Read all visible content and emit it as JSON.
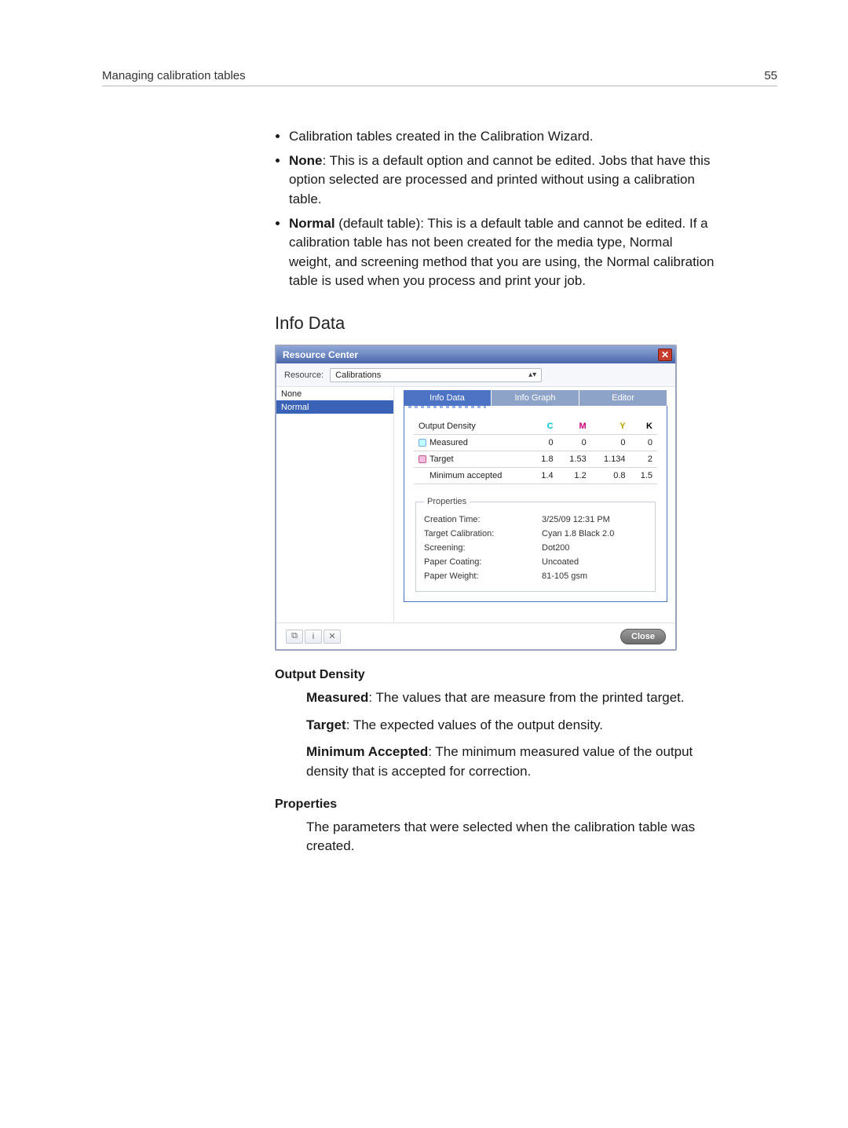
{
  "page": {
    "running_head": "Managing calibration tables",
    "page_number": "55"
  },
  "bullets": {
    "b1": "Calibration tables created in the Calibration Wizard.",
    "b2_label": "None",
    "b2_rest": ": This is a default option and cannot be edited. Jobs that have this option selected are processed and printed without using a calibration table.",
    "b3_label": "Normal",
    "b3_paren": " (default table): This is a default table and cannot be edited. If a calibration table has not been created for the media type, Normal weight, and screening method that you are using, the Normal calibration table is used when you process and print your job."
  },
  "heading": "Info Data",
  "window": {
    "title": "Resource Center",
    "resource_label": "Resource:",
    "resource_value": "Calibrations",
    "list": {
      "item0": "None",
      "item1": "Normal"
    },
    "tabs": {
      "info_data": "Info Data",
      "info_graph": "Info Graph",
      "editor": "Editor"
    },
    "table": {
      "h_output": "Output Density",
      "h_c": "C",
      "h_m": "M",
      "h_y": "Y",
      "h_k": "K",
      "r_measured": "Measured",
      "m_c": "0",
      "m_m": "0",
      "m_y": "0",
      "m_k": "0",
      "r_target": "Target",
      "t_c": "1.8",
      "t_m": "1.53",
      "t_y": "1.134",
      "t_k": "2",
      "r_min": "Minimum accepted",
      "x_c": "1.4",
      "x_m": "1.2",
      "x_y": "0.8",
      "x_k": "1.5"
    },
    "props": {
      "legend": "Properties",
      "k_creation": "Creation Time:",
      "v_creation": "3/25/09 12:31 PM",
      "k_target": "Target Calibration:",
      "v_target": "Cyan 1.8  Black 2.0",
      "k_screen": "Screening:",
      "v_screen": "Dot200",
      "k_coating": "Paper Coating:",
      "v_coating": "Uncoated",
      "k_weight": "Paper Weight:",
      "v_weight": "81-105 gsm"
    },
    "close": "Close"
  },
  "after": {
    "od_heading": "Output Density",
    "measured_label": "Measured",
    "measured_rest": ": The values that are measure from the printed target.",
    "target_label": "Target",
    "target_rest": ": The expected values of the output density.",
    "min_label": "Minimum Accepted",
    "min_rest": ": The minimum measured value of the output density that is accepted for correction.",
    "props_heading": "Properties",
    "props_text": "The parameters that were selected when the calibration table was created."
  },
  "chart_data": {
    "type": "table",
    "title": "Output Density",
    "columns": [
      "C",
      "M",
      "Y",
      "K"
    ],
    "rows": [
      {
        "name": "Measured",
        "values": [
          0,
          0,
          0,
          0
        ]
      },
      {
        "name": "Target",
        "values": [
          1.8,
          1.53,
          1.134,
          2
        ]
      },
      {
        "name": "Minimum accepted",
        "values": [
          1.4,
          1.2,
          0.8,
          1.5
        ]
      }
    ]
  }
}
